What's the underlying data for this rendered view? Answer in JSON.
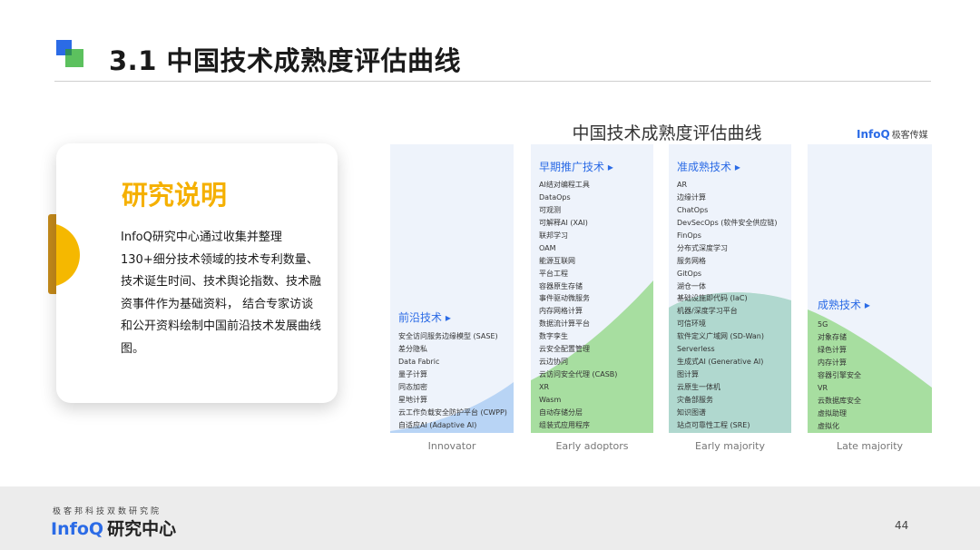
{
  "slide": {
    "title": "3.1 中国技术成熟度评估曲线",
    "page_number": "44"
  },
  "card": {
    "heading": "研究说明",
    "body": "InfoQ研究中心通过收集并整理130+细分技术领域的技术专利数量、技术诞生时间、技术舆论指数、技术融资事件作为基础资料， 结合专家访谈和公开资料绘制中国前沿技术发展曲线图。"
  },
  "chart": {
    "title": "中国技术成熟度评估曲线",
    "brand_bold": "InfoQ",
    "brand_text": "极客传媒",
    "colors": {
      "panel": "#eef3fb",
      "blue_fill": "#b8d4f5",
      "green_fill": "#a7dea0",
      "accent": "#2b6be6"
    }
  },
  "chart_data": {
    "type": "table",
    "columns": [
      {
        "heading": "前沿技术 ▸",
        "stage": "Innovator",
        "items": [
          "安全访问服务边缘模型 (SASE)",
          "差分隐私",
          "Data Fabric",
          "量子计算",
          "同态加密",
          "星地计算",
          "云工作负载安全防护平台 (CWPP)",
          "自适应AI (Adaptive AI)"
        ]
      },
      {
        "heading": "早期推广技术 ▸",
        "stage": "Early adoptors",
        "items": [
          "AI结对编程工具",
          "DataOps",
          "可观测",
          "可解释AI (XAI)",
          "联邦学习",
          "OAM",
          "能源互联网",
          "平台工程",
          "容器原生存储",
          "事件驱动微服务",
          "内存网格计算",
          "数据流计算平台",
          "数字孪生",
          "云安全配置管理",
          "云边协同",
          "云访问安全代理 (CASB)",
          "XR",
          "Wasm",
          "自动存储分层",
          "组装式应用程序"
        ]
      },
      {
        "heading": "准成熟技术 ▸",
        "stage": "Early majority",
        "items": [
          "AR",
          "边缘计算",
          "ChatOps",
          "DevSecOps (软件安全供应链)",
          "FinOps",
          "分布式深度学习",
          "服务网格",
          "GitOps",
          "湖仓一体",
          "基础设施即代码 (IaC)",
          "机器/深度学习平台",
          "可信环境",
          "软件定义广域网 (SD-Wan)",
          "Serverless",
          "生成式AI (Generative AI)",
          "图计算",
          "云原生一体机",
          "灾备部服务",
          "知识图谱",
          "站点可靠性工程 (SRE)"
        ]
      },
      {
        "heading": "成熟技术 ▸",
        "stage": "Late majority",
        "items": [
          "5G",
          "对象存储",
          "绿色计算",
          "内存计算",
          "容器引擎安全",
          "VR",
          "云数据库安全",
          "虚拟助理",
          "虚拟化"
        ]
      }
    ]
  },
  "footer": {
    "small_text": "极客邦科技双数研究院",
    "brand_bold": "InfoQ",
    "brand_text": "研究中心"
  }
}
